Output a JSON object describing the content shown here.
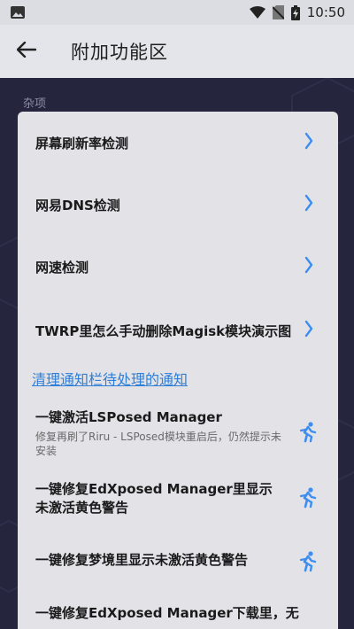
{
  "status_bar": {
    "time": "10:50",
    "icons": [
      "image-icon",
      "wifi-icon",
      "no-sim-icon",
      "battery-charging-icon"
    ]
  },
  "app_bar": {
    "back_icon": "arrow-left-icon",
    "title": "附加功能区"
  },
  "section": {
    "label": "杂项"
  },
  "menu": {
    "items": [
      {
        "label": "屏幕刷新率检测",
        "icon": "chevron-right-icon"
      },
      {
        "label": "网易DNS检测",
        "icon": "chevron-right-icon"
      },
      {
        "label": "网速检测",
        "icon": "chevron-right-icon"
      },
      {
        "label": "TWRP里怎么手动删除Magisk模块演示图",
        "icon": "chevron-right-icon"
      }
    ],
    "link": "清理通知栏待处理的通知",
    "actions": [
      {
        "title": "一键激活LSPosed Manager",
        "subtitle": "修复再刷了Riru - LSPosed模块重启后，仍然提示未安装",
        "icon": "running-person-icon"
      },
      {
        "title": "一键修复EdXposed Manager里显示未激活黄色警告",
        "subtitle": "",
        "icon": "running-person-icon"
      },
      {
        "title": "一键修复梦境里显示未激活黄色警告",
        "subtitle": "",
        "icon": "running-person-icon"
      },
      {
        "title": "一键修复EdXposed Manager下载里，无",
        "subtitle": "",
        "icon": "running-person-icon"
      }
    ]
  },
  "colors": {
    "accent": "#3d8ef0",
    "link": "#2f7fd6",
    "background": "#25263d",
    "card": "#e2e2e7"
  }
}
